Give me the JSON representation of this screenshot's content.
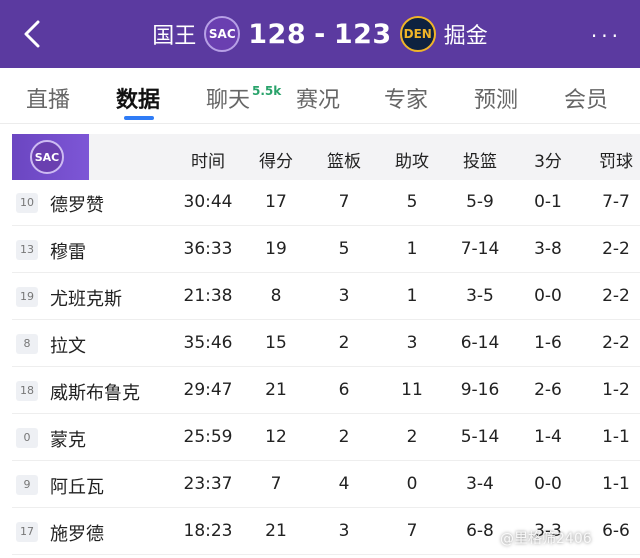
{
  "header": {
    "home_team": "国王",
    "home_abbr": "SAC",
    "home_score": "128",
    "separator": "-",
    "away_score": "123",
    "away_abbr": "DEN",
    "away_team": "掘金",
    "back_icon": "chevron-left-icon",
    "more_label": "···",
    "colors": {
      "header_bg": "#5b3aa0",
      "accent": "#2f7cf6"
    }
  },
  "tabs": [
    {
      "label": "直播",
      "active": false
    },
    {
      "label": "数据",
      "active": true
    },
    {
      "label": "聊天",
      "active": false,
      "badge": "5.5k"
    },
    {
      "label": "赛况",
      "active": false
    },
    {
      "label": "专家",
      "active": false
    },
    {
      "label": "预测",
      "active": false
    },
    {
      "label": "会员",
      "active": false
    }
  ],
  "table": {
    "team_abbr": "SAC",
    "columns": [
      "时间",
      "得分",
      "篮板",
      "助攻",
      "投篮",
      "3分",
      "罚球"
    ],
    "rows": [
      {
        "num": "10",
        "name": "德罗赞",
        "time": "30:44",
        "pts": "17",
        "reb": "7",
        "ast": "5",
        "fg": "5-9",
        "three": "0-1",
        "ft": "7-7"
      },
      {
        "num": "13",
        "name": "穆雷",
        "time": "36:33",
        "pts": "19",
        "reb": "5",
        "ast": "1",
        "fg": "7-14",
        "three": "3-8",
        "ft": "2-2"
      },
      {
        "num": "19",
        "name": "尤班克斯",
        "time": "21:38",
        "pts": "8",
        "reb": "3",
        "ast": "1",
        "fg": "3-5",
        "three": "0-0",
        "ft": "2-2"
      },
      {
        "num": "8",
        "name": "拉文",
        "time": "35:46",
        "pts": "15",
        "reb": "2",
        "ast": "3",
        "fg": "6-14",
        "three": "1-6",
        "ft": "2-2"
      },
      {
        "num": "18",
        "name": "威斯布鲁克",
        "time": "29:47",
        "pts": "21",
        "reb": "6",
        "ast": "11",
        "fg": "9-16",
        "three": "2-6",
        "ft": "1-2"
      },
      {
        "num": "0",
        "name": "蒙克",
        "time": "25:59",
        "pts": "12",
        "reb": "2",
        "ast": "2",
        "fg": "5-14",
        "three": "1-4",
        "ft": "1-1"
      },
      {
        "num": "9",
        "name": "阿丘瓦",
        "time": "23:37",
        "pts": "7",
        "reb": "4",
        "ast": "0",
        "fg": "3-4",
        "three": "0-0",
        "ft": "1-1"
      },
      {
        "num": "17",
        "name": "施罗德",
        "time": "18:23",
        "pts": "21",
        "reb": "3",
        "ast": "7",
        "fg": "6-8",
        "three": "3-3",
        "ft": "6-6"
      }
    ]
  },
  "watermark": "@里格筛2406"
}
